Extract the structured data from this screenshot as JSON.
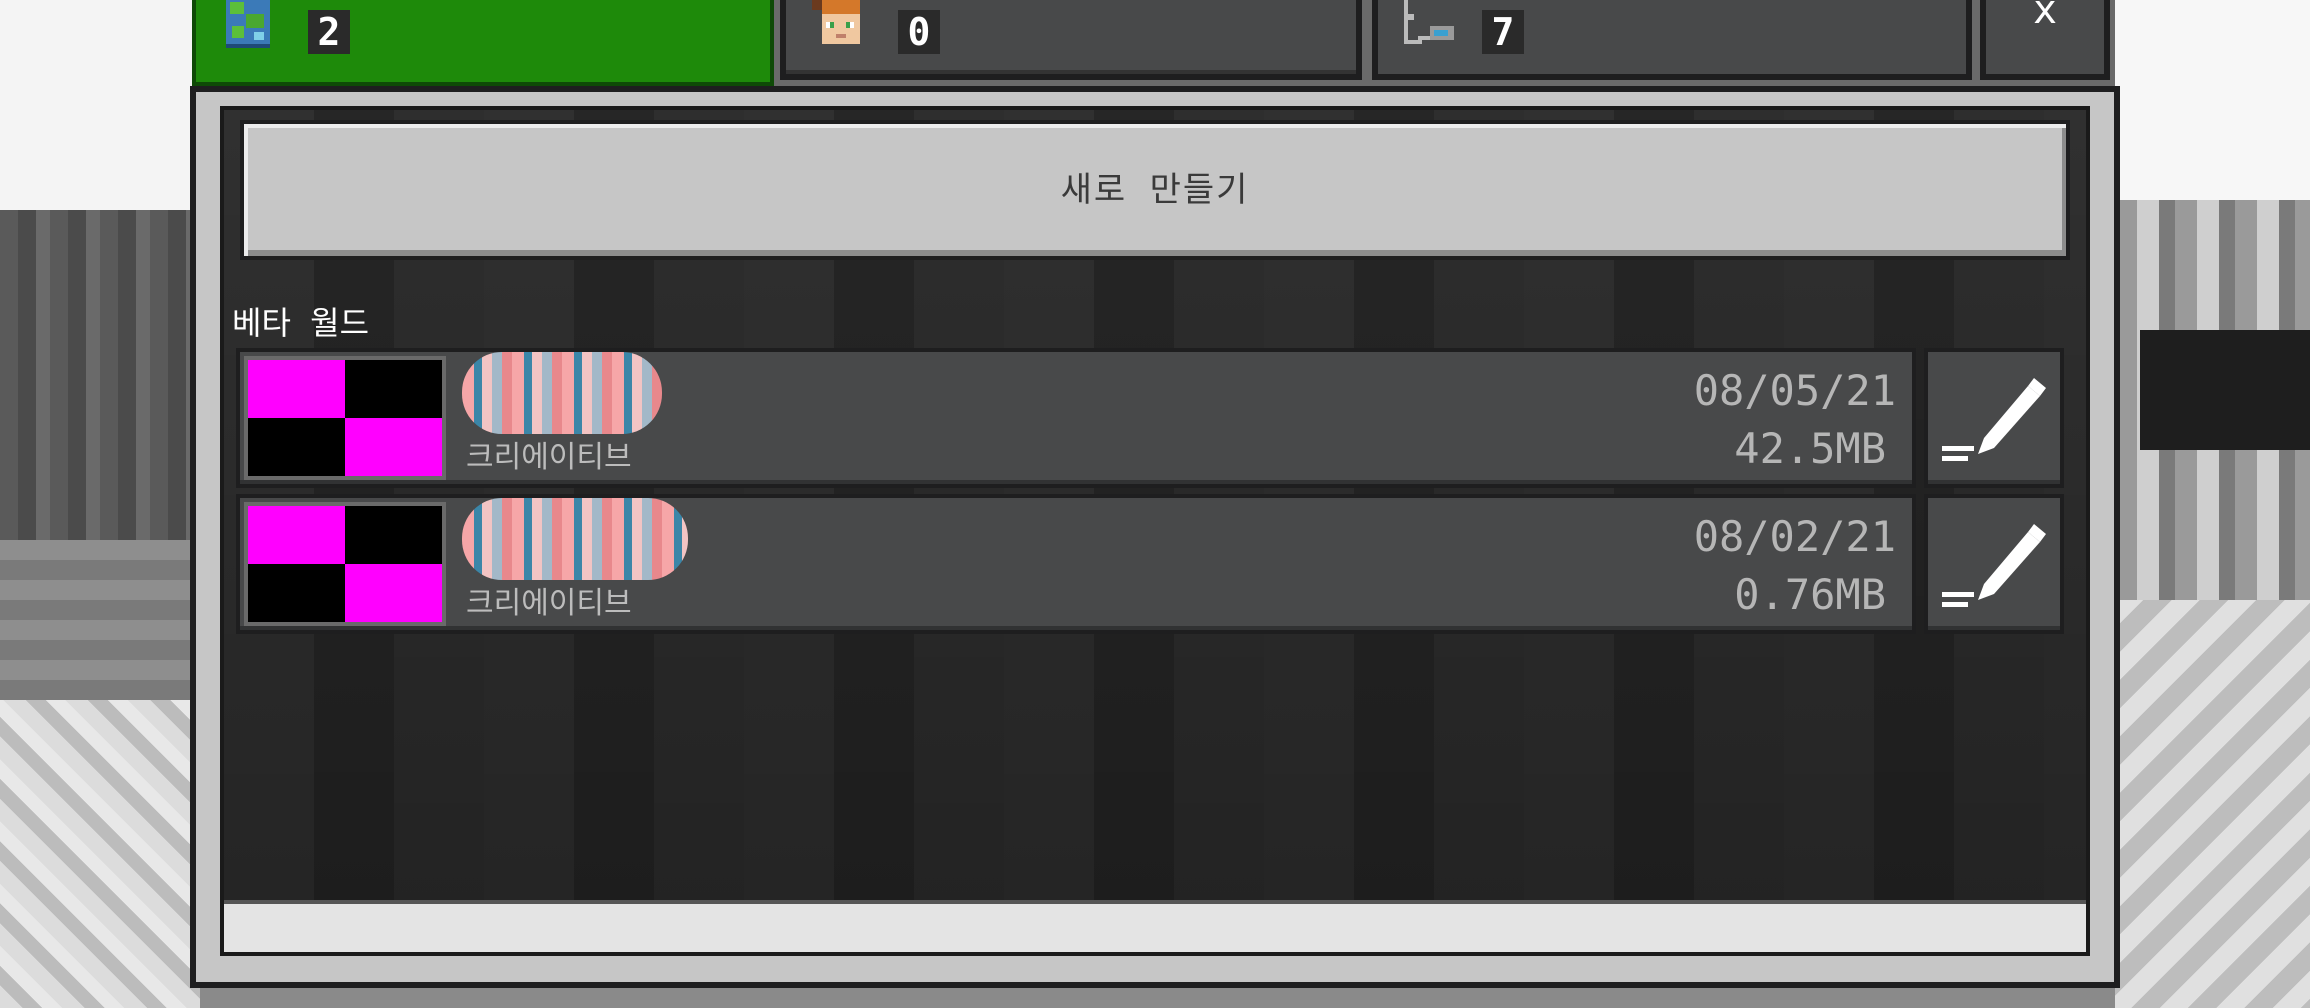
{
  "tabs": [
    {
      "icon": "world-globe-icon",
      "count": "2",
      "active": true
    },
    {
      "icon": "player-face-icon",
      "count": "0",
      "active": false
    },
    {
      "icon": "server-icon",
      "count": "7",
      "active": false
    }
  ],
  "close_label": "x",
  "create_button": {
    "label": "새로 만들기"
  },
  "section": {
    "label": "베타 월드"
  },
  "worlds": [
    {
      "mode": "크리에이티브",
      "date": "08/05/21",
      "size": "42.5MB"
    },
    {
      "mode": "크리에이티브",
      "date": "08/02/21",
      "size": "0.76MB"
    }
  ],
  "colors": {
    "active_tab": "#1e8a0a",
    "panel": "#c6c6c6",
    "row": "#48494a",
    "thumb_magenta": "#ff00ff"
  }
}
